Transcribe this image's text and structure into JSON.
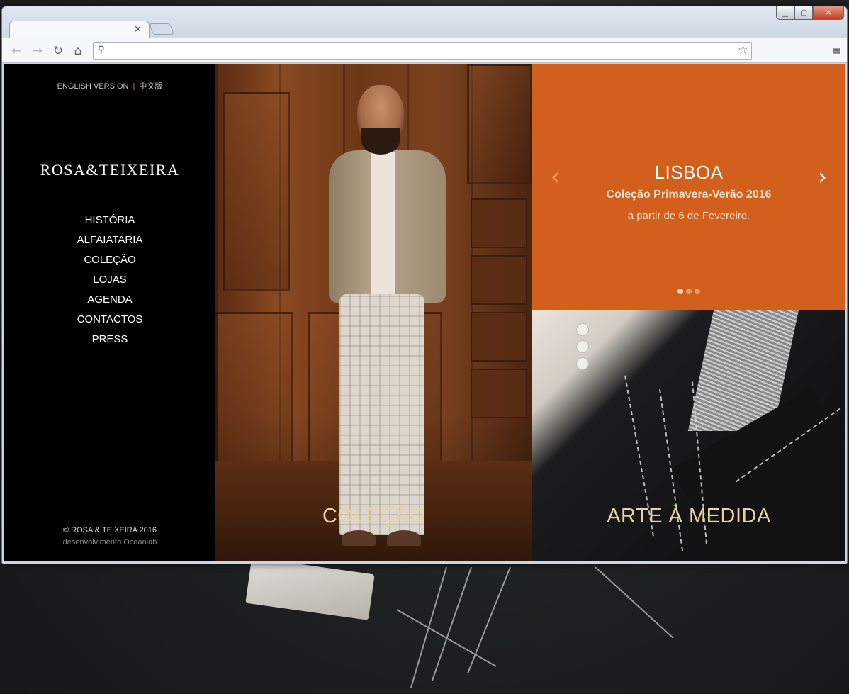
{
  "browser": {
    "tab_close": "×",
    "icons": {
      "back": "back-arrow-icon",
      "forward": "forward-arrow-icon",
      "reload": "reload-icon",
      "home": "home-icon",
      "search": "search-icon",
      "bookmark": "star-icon",
      "menu": "hamburger-menu-icon"
    },
    "address": ""
  },
  "sidebar": {
    "lang_en": "ENGLISH VERSION",
    "lang_sep": "|",
    "lang_zh": "中文版",
    "logo": "ROSA&TEIXEIRA",
    "menu": [
      {
        "label": "HISTÓRIA"
      },
      {
        "label": "ALFAIATARIA"
      },
      {
        "label": "COLEÇÃO"
      },
      {
        "label": "LOJAS"
      },
      {
        "label": "AGENDA"
      },
      {
        "label": "CONTACTOS"
      },
      {
        "label": "PRESS"
      }
    ],
    "copyright": "© ROSA & TEIXEIRA 2016",
    "developer": "desenvolvimento Oceanlab"
  },
  "panels": {
    "collection_title": "COLEÇÃO",
    "arte_title": "ARTE À MEDIDA"
  },
  "slider": {
    "title": "LISBOA",
    "subtitle": "Coleção Primavera-Verão 2016",
    "date": "a partir de 6 de Fevereiro.",
    "prev": "‹",
    "next": "›",
    "dots": 3,
    "active_dot": 0
  },
  "colors": {
    "slider_bg": "#d2601c",
    "panel_title": "#e6d3a8",
    "sidebar_bg": "#000000"
  }
}
